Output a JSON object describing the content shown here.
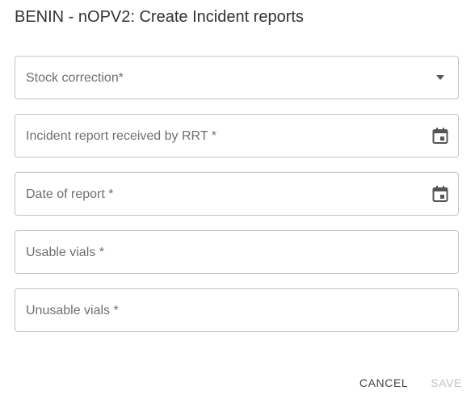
{
  "dialog": {
    "title": "BENIN - nOPV2: Create Incident reports"
  },
  "form": {
    "fields": [
      {
        "label": "Stock correction*",
        "type": "select",
        "icon": "dropdown-arrow-icon"
      },
      {
        "label": "Incident report received by RRT *",
        "type": "date",
        "icon": "calendar-icon"
      },
      {
        "label": "Date of report *",
        "type": "date",
        "icon": "calendar-icon"
      },
      {
        "label": "Usable vials *",
        "type": "number"
      },
      {
        "label": "Unusable vials *",
        "type": "number"
      }
    ]
  },
  "actions": {
    "cancel_label": "CANCEL",
    "save_label": "SAVE"
  },
  "colors": {
    "icon": "#555555",
    "border": "#c4c4c4",
    "disabled": "#c2c2c2"
  }
}
